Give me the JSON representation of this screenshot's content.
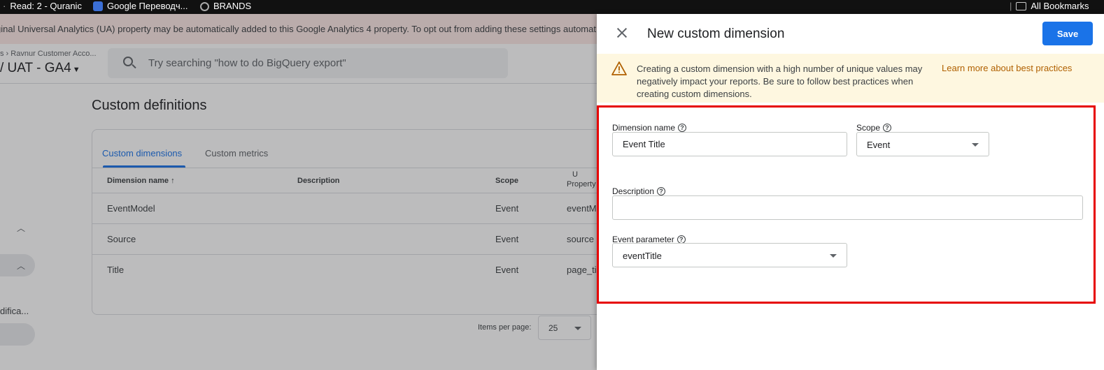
{
  "bookmarks_bar": {
    "items": [
      "Read: 2 - Quranic",
      "Google Переводч...",
      "BRANDS"
    ],
    "right_item": "All Bookmarks"
  },
  "background": {
    "notice_text": "ginal Universal Analytics (UA) property may be automatically added to this Google Analytics 4 property. To opt out from adding these settings automat",
    "breadcrumb": "s  ›  Ravnur Customer Acco...",
    "property_name": "/ UAT - GA4",
    "search_placeholder": "Try searching \"how to do BigQuery export\"",
    "nav_text": "dificа...",
    "page_title": "Custom definitions",
    "tabs": [
      "Custom dimensions",
      "Custom metrics"
    ],
    "columns": [
      "Dimension name",
      "Description",
      "Scope",
      "Property"
    ],
    "col_extra": "U",
    "rows": [
      {
        "name": "EventModel",
        "description": "",
        "scope": "Event",
        "property": "eventM"
      },
      {
        "name": "Source",
        "description": "",
        "scope": "Event",
        "property": "source"
      },
      {
        "name": "Title",
        "description": "",
        "scope": "Event",
        "property": "page_ti"
      }
    ],
    "items_per_page_label": "Items per page:",
    "items_per_page_value": "25"
  },
  "drawer": {
    "title": "New custom dimension",
    "save_label": "Save",
    "warning_text": "Creating a custom dimension with a high number of unique values may negatively impact your reports. Be sure to follow best practices when creating custom dimensions.",
    "warning_link": "Learn more about best practices",
    "dimension_name_label": "Dimension name",
    "dimension_name_value": "Event Title",
    "scope_label": "Scope",
    "scope_value": "Event",
    "description_label": "Description",
    "description_value": "",
    "event_parameter_label": "Event parameter",
    "event_parameter_value": "eventTitle",
    "help_glyph": "?"
  },
  "colors": {
    "accent": "#1a73e8",
    "warning_bg": "#fef7e0",
    "warning_link": "#b06000",
    "highlight_border": "#e60000",
    "notice_bg": "#fce8e6"
  }
}
